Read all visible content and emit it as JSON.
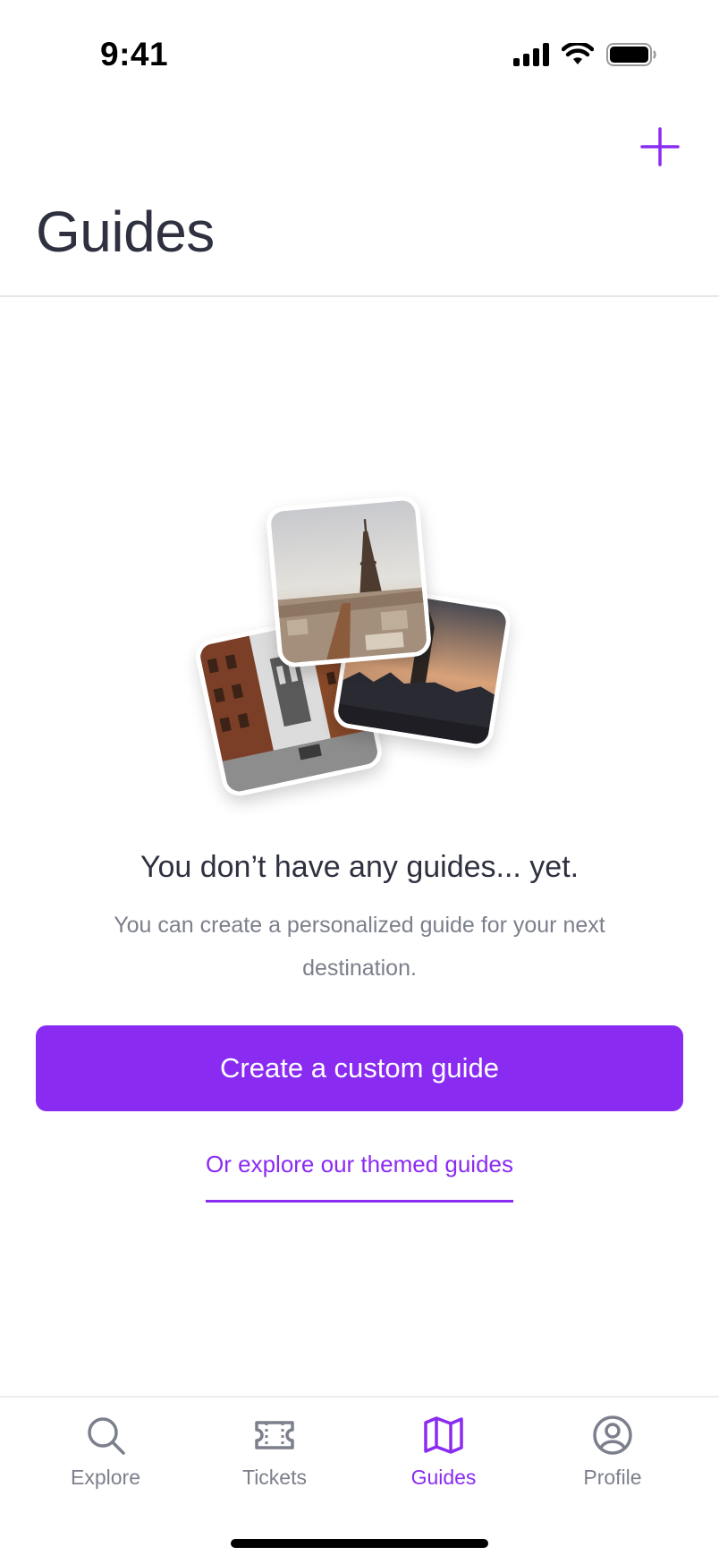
{
  "status_bar": {
    "time": "9:41"
  },
  "header": {
    "title": "Guides"
  },
  "empty_state": {
    "title": "You don’t have any guides... yet.",
    "subtitle": "You can create a personalized guide for your next destination."
  },
  "actions": {
    "create_label": "Create a custom guide",
    "explore_label": "Or explore our themed guides"
  },
  "tabs": [
    {
      "label": "Explore",
      "icon": "search-icon",
      "active": false
    },
    {
      "label": "Tickets",
      "icon": "ticket-icon",
      "active": false
    },
    {
      "label": "Guides",
      "icon": "map-icon",
      "active": true
    },
    {
      "label": "Profile",
      "icon": "profile-icon",
      "active": false
    }
  ],
  "colors": {
    "accent": "#8a2bf2",
    "text": "#2f3140",
    "muted": "#7c7f8c"
  }
}
